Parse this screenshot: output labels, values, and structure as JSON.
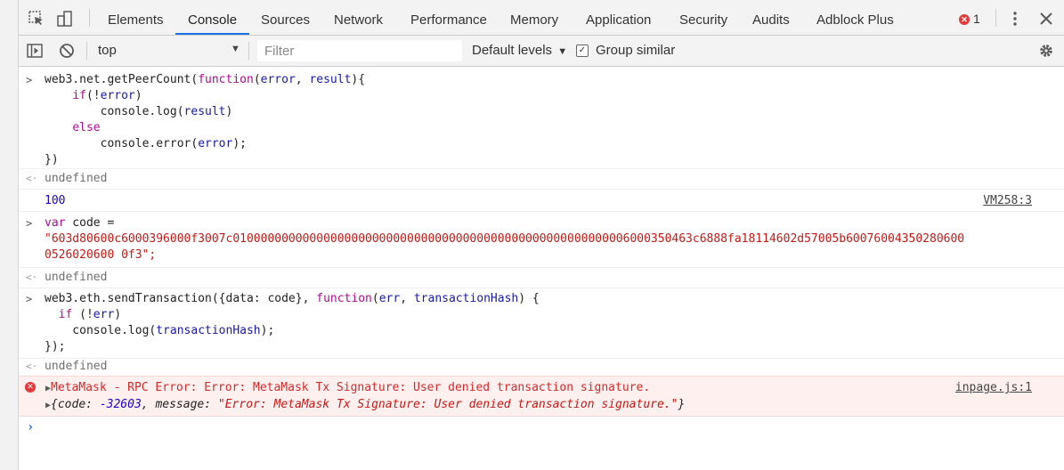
{
  "tabs": [
    "Elements",
    "Console",
    "Sources",
    "Network",
    "Performance",
    "Memory",
    "Application",
    "Security",
    "Audits",
    "Adblock Plus"
  ],
  "error_count": "1",
  "toolbar": {
    "context": "top",
    "filter_placeholder": "Filter",
    "levels": "Default levels",
    "group_similar": "Group similar"
  },
  "console": {
    "block1": {
      "l1a": "web3.net.getPeerCount(",
      "l1b": "function",
      "l1c": "(",
      "l1d": "error",
      "l1e": ", ",
      "l1f": "result",
      "l1g": "){",
      "l2a": "    ",
      "l2b": "if",
      "l2c": "(!",
      "l2d": "error",
      "l2e": ")",
      "l3a": "        console.log(",
      "l3b": "result",
      "l3c": ")",
      "l4a": "    ",
      "l4b": "else",
      "l5a": "        console.error(",
      "l5b": "error",
      "l5c": ");",
      "l6": "})"
    },
    "undefined": "undefined",
    "log_value": "100",
    "log_source": "VM258:3",
    "block2": {
      "l1a": "var",
      "l1b": " code =",
      "l2": "\"603d80600c6000396000f3007c010000000000000000000000000000000000000000000000000000006000350463c6888fa18114602d57005b60076004350280600",
      "l3": "0526020600 0f3\";"
    },
    "block3": {
      "l1a": "web3.eth.sendTransaction({data: code}, ",
      "l1b": "function",
      "l1c": "(",
      "l1d": "err",
      "l1e": ", ",
      "l1f": "transactionHash",
      "l1g": ") {",
      "l2a": "  ",
      "l2b": "if",
      "l2c": " (!",
      "l2d": "err",
      "l2e": ")",
      "l3a": "    console.log(",
      "l3b": "transactionHash",
      "l3c": ");",
      "l4": "});"
    },
    "error": {
      "message": "MetaMask - RPC Error: Error: MetaMask Tx Signature: User denied transaction signature.",
      "source": "inpage.js:1",
      "obj_open": "{",
      "obj_k1": "code: ",
      "obj_v1": "-32603",
      "obj_k2": ", message: ",
      "obj_v2": "\"Error: MetaMask Tx Signature: User denied transaction signature.\"",
      "obj_close": "}"
    }
  }
}
